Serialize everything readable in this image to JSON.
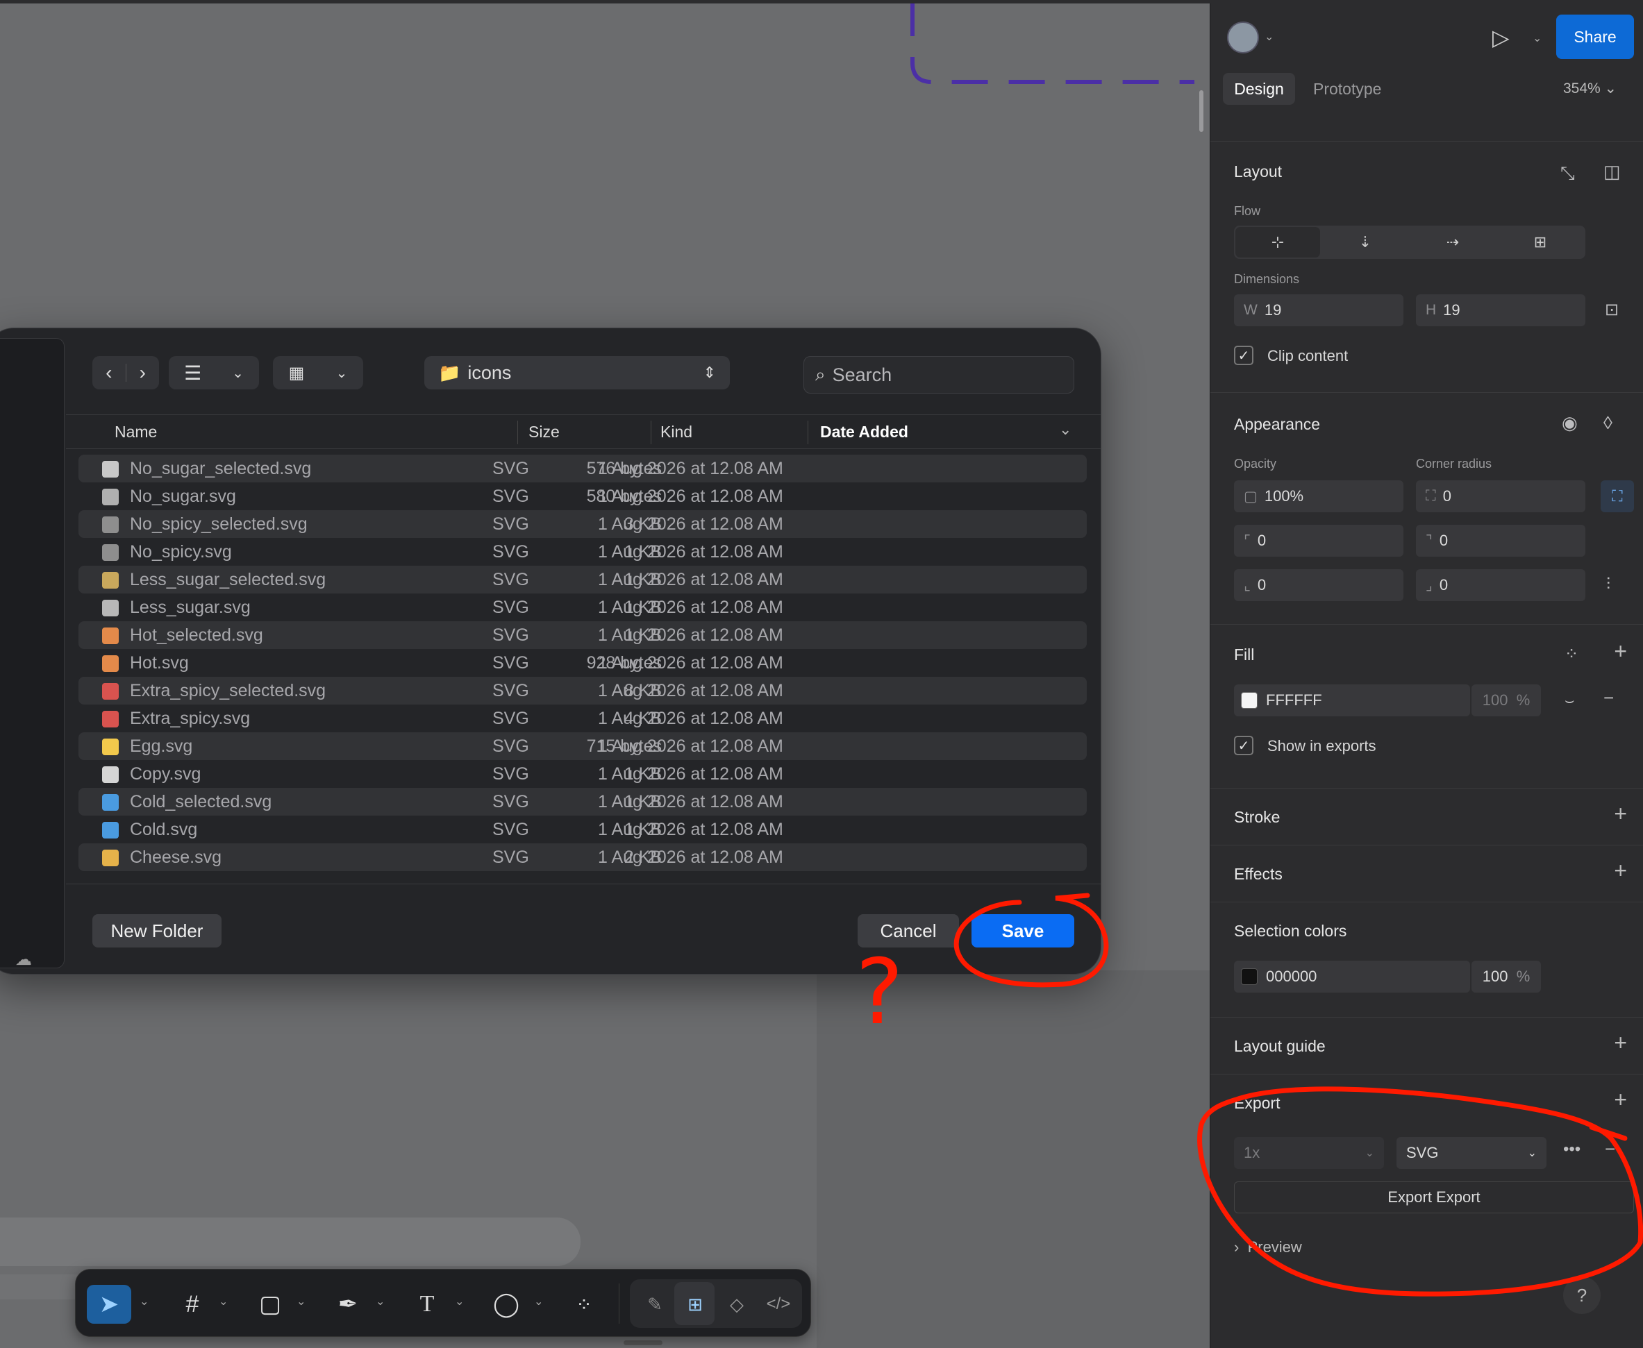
{
  "dialog": {
    "location": "icons",
    "search_placeholder": "Search",
    "columns": {
      "name": "Name",
      "size": "Size",
      "kind": "Kind",
      "date": "Date Added"
    },
    "files": [
      {
        "name": "No_sugar_selected.svg",
        "size": "576 bytes",
        "kind": "SVG",
        "date": "1 Aug 2026 at 12.08 AM",
        "icon_color": "#c8c8c8"
      },
      {
        "name": "No_sugar.svg",
        "size": "580 bytes",
        "kind": "SVG",
        "date": "1 Aug 2026 at 12.08 AM",
        "icon_color": "#b0b0b0"
      },
      {
        "name": "No_spicy_selected.svg",
        "size": "3 KB",
        "kind": "SVG",
        "date": "1 Aug 2026 at 12.08 AM",
        "icon_color": "#8e8e8e"
      },
      {
        "name": "No_spicy.svg",
        "size": "1 KB",
        "kind": "SVG",
        "date": "1 Aug 2026 at 12.08 AM",
        "icon_color": "#8e8e8e"
      },
      {
        "name": "Less_sugar_selected.svg",
        "size": "1 KB",
        "kind": "SVG",
        "date": "1 Aug 2026 at 12.08 AM",
        "icon_color": "#c9a85c"
      },
      {
        "name": "Less_sugar.svg",
        "size": "1 KB",
        "kind": "SVG",
        "date": "1 Aug 2026 at 12.08 AM",
        "icon_color": "#b8b8b8"
      },
      {
        "name": "Hot_selected.svg",
        "size": "1 KB",
        "kind": "SVG",
        "date": "1 Aug 2026 at 12.08 AM",
        "icon_color": "#e38a4a"
      },
      {
        "name": "Hot.svg",
        "size": "928 bytes",
        "kind": "SVG",
        "date": "1 Aug 2026 at 12.08 AM",
        "icon_color": "#e38a4a"
      },
      {
        "name": "Extra_spicy_selected.svg",
        "size": "8 KB",
        "kind": "SVG",
        "date": "1 Aug 2026 at 12.08 AM",
        "icon_color": "#d9534f"
      },
      {
        "name": "Extra_spicy.svg",
        "size": "4 KB",
        "kind": "SVG",
        "date": "1 Aug 2026 at 12.08 AM",
        "icon_color": "#d9534f"
      },
      {
        "name": "Egg.svg",
        "size": "715 bytes",
        "kind": "SVG",
        "date": "1 Aug 2026 at 12.08 AM",
        "icon_color": "#f2c94c"
      },
      {
        "name": "Copy.svg",
        "size": "1 KB",
        "kind": "SVG",
        "date": "1 Aug 2026 at 12.08 AM",
        "icon_color": "#d5d5d5"
      },
      {
        "name": "Cold_selected.svg",
        "size": "1 KB",
        "kind": "SVG",
        "date": "1 Aug 2026 at 12.08 AM",
        "icon_color": "#4a9be0"
      },
      {
        "name": "Cold.svg",
        "size": "1 KB",
        "kind": "SVG",
        "date": "1 Aug 2026 at 12.08 AM",
        "icon_color": "#4a9be0"
      },
      {
        "name": "Cheese.svg",
        "size": "2 KB",
        "kind": "SVG",
        "date": "1 Aug 2026 at 12.08 AM",
        "icon_color": "#e5b24a"
      }
    ],
    "new_folder_label": "New Folder",
    "cancel_label": "Cancel",
    "save_label": "Save",
    "accent_color": "#0a6cf3"
  },
  "panel": {
    "share_label": "Share",
    "tabs": {
      "design": "Design",
      "prototype": "Prototype"
    },
    "zoom": "354%",
    "layout": {
      "title": "Layout",
      "flow_label": "Flow",
      "dimensions_label": "Dimensions",
      "width_prefix": "W",
      "width": "19",
      "height_prefix": "H",
      "height": "19",
      "clip_content_label": "Clip content",
      "clip_content_checked": true
    },
    "appearance": {
      "title": "Appearance",
      "opacity_label": "Opacity",
      "opacity": "100%",
      "corner_radius_label": "Corner radius",
      "corner_radius": "0",
      "corner_tl": "0",
      "corner_tr": "0",
      "corner_bl": "0",
      "corner_br": "0"
    },
    "fill": {
      "title": "Fill",
      "hex": "FFFFFF",
      "opacity": "100",
      "percent": "%",
      "show_in_exports_label": "Show in exports",
      "show_in_exports_checked": true
    },
    "stroke_title": "Stroke",
    "effects_title": "Effects",
    "selection_colors": {
      "title": "Selection colors",
      "hex": "000000",
      "opacity": "100",
      "percent": "%"
    },
    "layout_guide_title": "Layout guide",
    "export": {
      "title": "Export",
      "scale": "1x",
      "format": "SVG",
      "button_label": "Export Export",
      "preview_label": "Preview"
    },
    "help": "?"
  },
  "annotation": {
    "question_mark": "?",
    "color": "#ff1a00"
  }
}
